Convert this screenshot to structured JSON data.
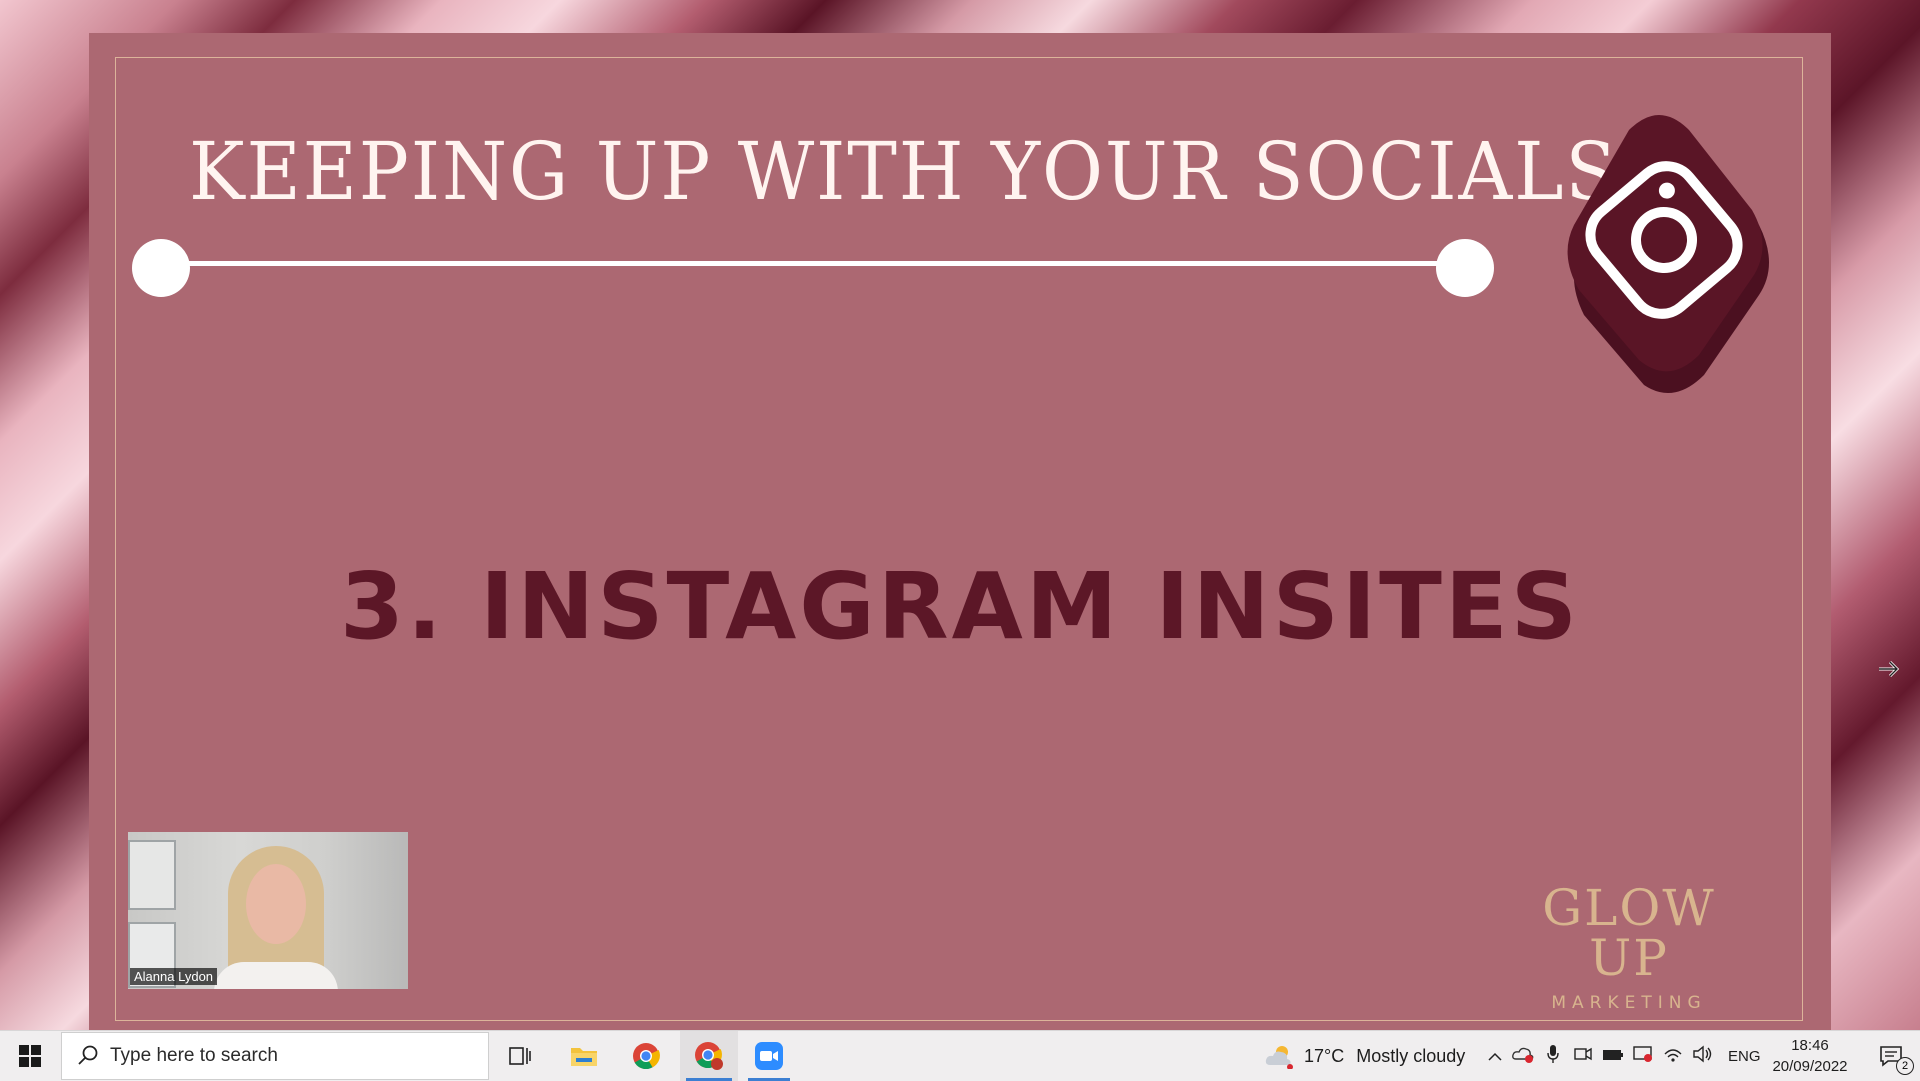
{
  "slide": {
    "title": "KEEPING UP WITH YOUR SOCIALS",
    "section_heading": "3. INSTAGRAM INSITES",
    "brand_top": "GLOW UP",
    "brand_bottom": "MARKETING"
  },
  "video": {
    "participant_name": "Alanna Lydon"
  },
  "taskbar": {
    "search_placeholder": "Type here to search",
    "weather_temp": "17°C",
    "weather_desc": "Mostly cloudy",
    "language": "ENG",
    "time": "18:46",
    "date": "20/09/2022",
    "notification_count": "2",
    "apps": [
      "task-view",
      "file-explorer",
      "chrome",
      "chrome-profile",
      "zoom"
    ]
  },
  "colors": {
    "slide_bg": "#ac6872",
    "heading": "#5c1727",
    "brand": "#d8b48e",
    "accent": "#3c7fd2"
  }
}
